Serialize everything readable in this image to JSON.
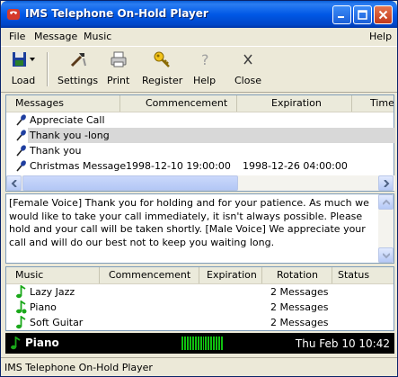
{
  "window": {
    "title": "IMS Telephone On-Hold Player"
  },
  "menu": {
    "file": "File",
    "message": "Message",
    "music": "Music",
    "help": "Help"
  },
  "toolbar": {
    "load": "Load",
    "settings": "Settings",
    "print": "Print",
    "register": "Register",
    "help": "Help",
    "close": "Close"
  },
  "messages": {
    "columns": [
      "Messages",
      "Commencement",
      "Expiration",
      "Time"
    ],
    "rows": [
      {
        "name": "Appreciate Call",
        "commencement": "",
        "expiration": "",
        "selected": false
      },
      {
        "name": "Thank you -long",
        "commencement": "",
        "expiration": "",
        "selected": true
      },
      {
        "name": "Thank you",
        "commencement": "",
        "expiration": "",
        "selected": false
      },
      {
        "name": "Christmas Message",
        "commencement": "1998-12-10 19:00:00",
        "expiration": "1998-12-26 04:00:00",
        "selected": false
      }
    ]
  },
  "message_text": "[Female Voice] Thank you for holding and for your patience. As much we would like to take your call immediately, it isn't always possible. Please hold and your call will be taken shortly. [Male Voice] We appreciate your call and will do our best not to keep you waiting long.",
  "music": {
    "columns": [
      "Music",
      "Commencement",
      "Expiration",
      "Rotation",
      "Status"
    ],
    "rows": [
      {
        "name": "Lazy Jazz",
        "rotation": "2 Messages",
        "playing": false
      },
      {
        "name": "Piano",
        "rotation": "2 Messages",
        "playing": true
      },
      {
        "name": "Soft Guitar",
        "rotation": "2 Messages",
        "playing": false
      }
    ]
  },
  "now_playing": {
    "title": "Piano",
    "datetime": "Thu Feb 10 10:42"
  },
  "status": {
    "text": "IMS Telephone On-Hold Player"
  },
  "colors": {
    "titlebar": "#0058e6",
    "selection": "#d8d8d8",
    "music_icon": "#1aa81a",
    "mic_icon": "#1f3fa0",
    "level_meter": "#10c010"
  }
}
